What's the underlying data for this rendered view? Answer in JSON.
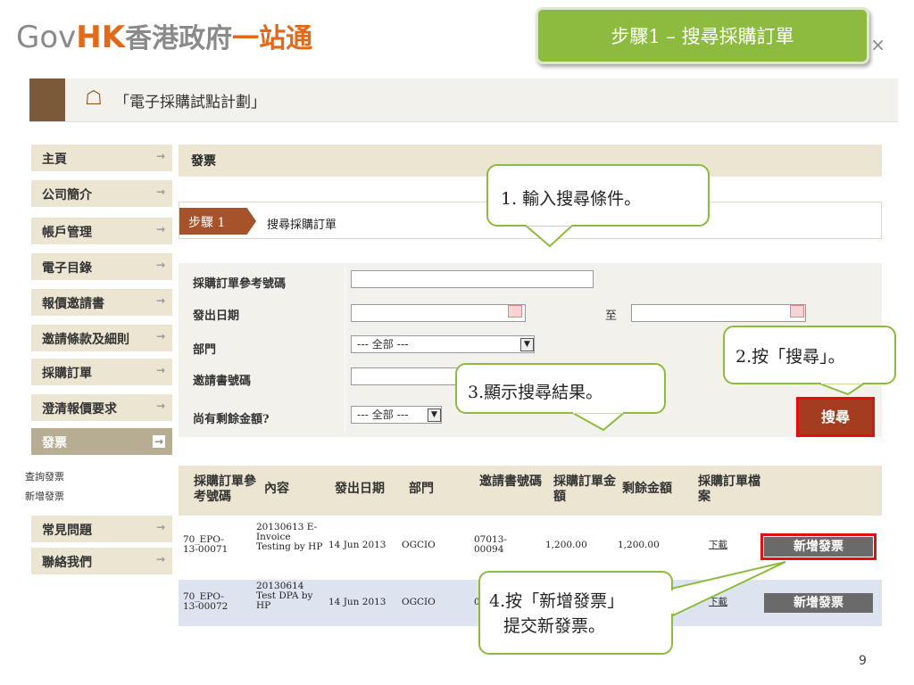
{
  "header": {
    "logo_gov": "Gov",
    "logo_hk": "HK",
    "logo_cn_grey": "香港政府",
    "logo_cn_orange": "一站通",
    "close_glyph": "×"
  },
  "slide_title": "步驟1 – 搜尋採購訂單",
  "program_title": "「電子採購試點計劃」",
  "sidebar": {
    "items": [
      {
        "label": "主頁"
      },
      {
        "label": "公司簡介"
      },
      {
        "label": "帳戶管理"
      },
      {
        "label": "電子目錄"
      },
      {
        "label": "報價邀請書"
      },
      {
        "label": "邀請條款及細則"
      },
      {
        "label": "採購訂單"
      },
      {
        "label": "澄清報價要求"
      },
      {
        "label": "發票"
      }
    ],
    "sub_items": [
      {
        "label": "查詢發票"
      },
      {
        "label": "新增發票"
      }
    ],
    "items_after": [
      {
        "label": "常見問題"
      },
      {
        "label": "聯絡我們"
      }
    ],
    "arrow_glyph": "→"
  },
  "main": {
    "section_title": "發票",
    "step_badge": "步驟 1",
    "step_text": "搜尋採購訂單",
    "form": {
      "po_ref_label": "採購訂單參考號碼",
      "issue_date_label": "發出日期",
      "to_label": "至",
      "dept_label": "部門",
      "dept_value": "--- 全部 ---",
      "invitation_no_label": "邀請書號碼",
      "balance_label": "尚有剩餘金額?",
      "balance_value": "--- 全部 ---",
      "search_button": "搜尋"
    },
    "table": {
      "headers": [
        "採購訂單參考號碼",
        "內容",
        "發出日期",
        "部門",
        "邀請書號碼",
        "採購訂單金額",
        "剩餘金額",
        "採購訂單檔案"
      ],
      "rows": [
        {
          "po_ref": "70_EPO-13-00071",
          "content": "20130613 E-Invoice Testing by HP",
          "date": "14 Jun 2013",
          "dept": "OGCIO",
          "invitation": "07013-00094",
          "amount": "1,200.00",
          "balance": "1,200.00",
          "file": "下載",
          "action": "新增發票"
        },
        {
          "po_ref": "70_EPO-13-00072",
          "content": "20130614 Test DPA by HP",
          "date": "14 Jun 2013",
          "dept": "OGCIO",
          "invitation": "0",
          "amount": "",
          "balance": "",
          "file": "下載",
          "action": "新增發票"
        }
      ]
    }
  },
  "callouts": {
    "c1": "1. 輸入搜尋條件。",
    "c2": "2.按「搜尋」。",
    "c3": "3.顯示搜尋結果。",
    "c4_line1": "4.按「新增發票」",
    "c4_line2": "提交新發票。"
  },
  "page_number": "9",
  "colors": {
    "accent_green": "#8dbb3f",
    "brand_orange": "#e06a1a",
    "button_red": "#a43d1f",
    "highlight_red": "#e01010"
  }
}
